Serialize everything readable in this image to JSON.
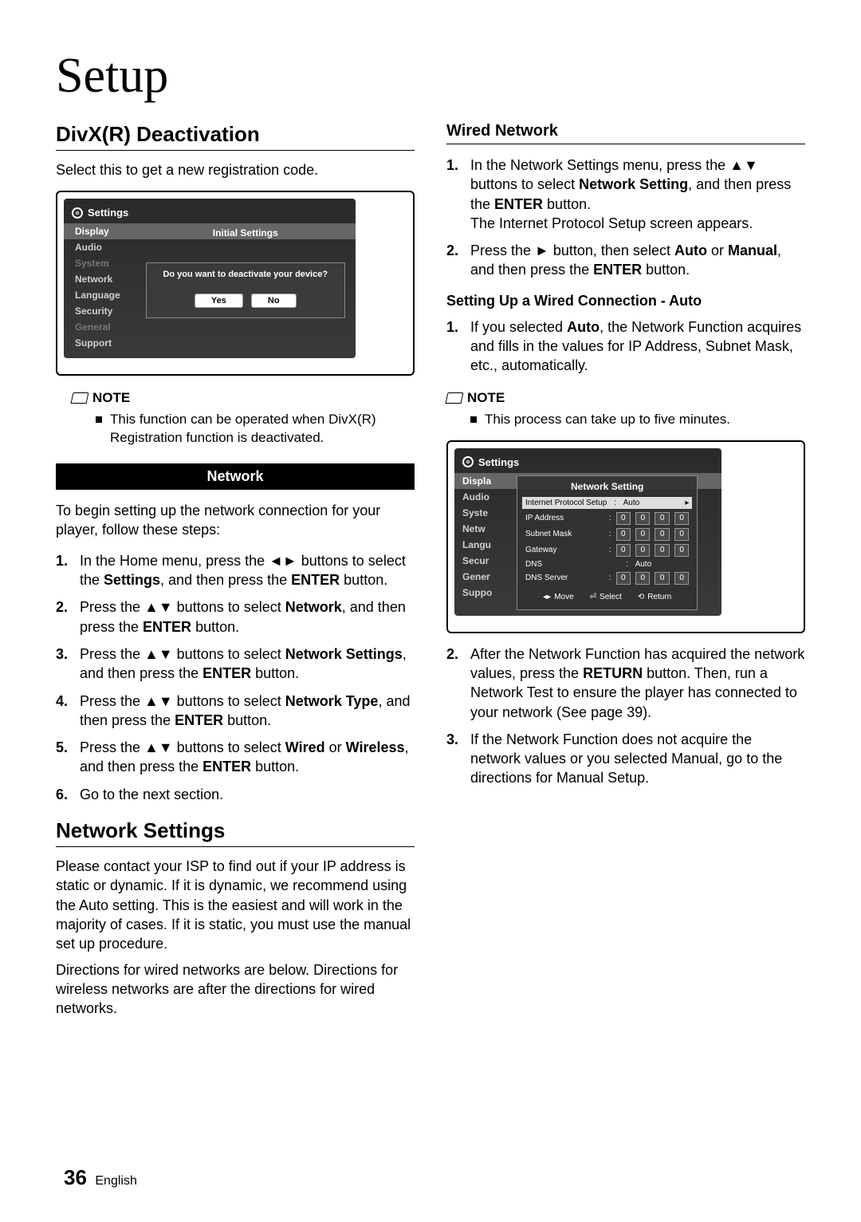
{
  "pageTitle": "Setup",
  "left": {
    "h_divx": "DivX(R) Deactivation",
    "divx_intro": "Select this to get a new registration code.",
    "tv1": {
      "title": "Settings",
      "menu": [
        "Display",
        "Audio",
        "System",
        "Network",
        "Language",
        "Security",
        "General",
        "Support"
      ],
      "dialog_title": "Initial Settings",
      "dialog_text": "Do you want to deactivate your device?",
      "yes": "Yes",
      "no": "No"
    },
    "note_label": "NOTE",
    "note1": "This function can be operated when DivX(R) Registration function is deactivated.",
    "section_bar": "Network",
    "net_intro": "To begin setting up the network connection for your player, follow these steps:",
    "steps": [
      "In the Home menu, press the ◄► buttons to select the <b>Settings</b>, and then press the <b>ENTER</b> button.",
      "Press the ▲▼ buttons to select <b>Network</b>, and then press the <b>ENTER</b> button.",
      "Press the ▲▼ buttons to select <b>Network Settings</b>, and then press the <b>ENTER</b> button.",
      "Press the ▲▼ buttons to select <b>Network Type</b>, and then press the <b>ENTER</b> button.",
      "Press the ▲▼ buttons to select <b>Wired</b> or <b>Wireless</b>, and then press the <b>ENTER</b> button.",
      "Go to the next section."
    ],
    "h_netset": "Network Settings",
    "netset_p1": "Please contact your ISP to find out if your IP address is static or dynamic. If it is dynamic, we recommend using the Auto setting. This is the easiest and will work in the majority of cases. If it is static, you must use the manual set up procedure.",
    "netset_p2": "Directions for wired networks are below. Directions for wireless networks are after the directions for wired networks."
  },
  "right": {
    "h_wired": "Wired Network",
    "wired_steps_a": [
      "In the Network Settings menu, press the ▲▼ buttons to select <b>Network Setting</b>, and then press the <b>ENTER</b> button.<br>The Internet Protocol Setup screen appears.",
      "Press the ► button, then select <b>Auto</b> or <b>Manual</b>, and then press the <b>ENTER</b> button."
    ],
    "h_auto": "Setting Up a Wired Connection - Auto",
    "auto_step1": "If you selected <b>Auto</b>, the Network Function acquires and fills in the values for IP Address, Subnet Mask, etc., automatically.",
    "note_label": "NOTE",
    "note2": "This process can take up to five minutes.",
    "tv2": {
      "title": "Settings",
      "menu": [
        "Display",
        "Audio",
        "System",
        "Network",
        "Language",
        "Security",
        "General",
        "Support"
      ],
      "box_title": "Network Setting",
      "ip_setup_label": "Internet Protocol Setup",
      "ip_setup_val": "Auto",
      "rows": [
        {
          "label": "IP Address",
          "v": [
            "0",
            "0",
            "0",
            "0"
          ]
        },
        {
          "label": "Subnet Mask",
          "v": [
            "0",
            "0",
            "0",
            "0"
          ]
        },
        {
          "label": "Gateway",
          "v": [
            "0",
            "0",
            "0",
            "0"
          ]
        }
      ],
      "dns_label": "DNS",
      "dns_val": "Auto",
      "dns_server": {
        "label": "DNS Server",
        "v": [
          "0",
          "0",
          "0",
          "0"
        ]
      },
      "bottom": {
        "move": "Move",
        "select": "Select",
        "return": "Return"
      }
    },
    "post_steps": [
      "After the Network Function has acquired the network values, press the <b>RETURN</b> button. Then, run a Network Test to ensure the player has connected to your network (See page 39).",
      "If the Network Function does not acquire the network values or you selected Manual, go to the directions for Manual Setup."
    ]
  },
  "footer": {
    "num": "36",
    "lang": "English"
  }
}
